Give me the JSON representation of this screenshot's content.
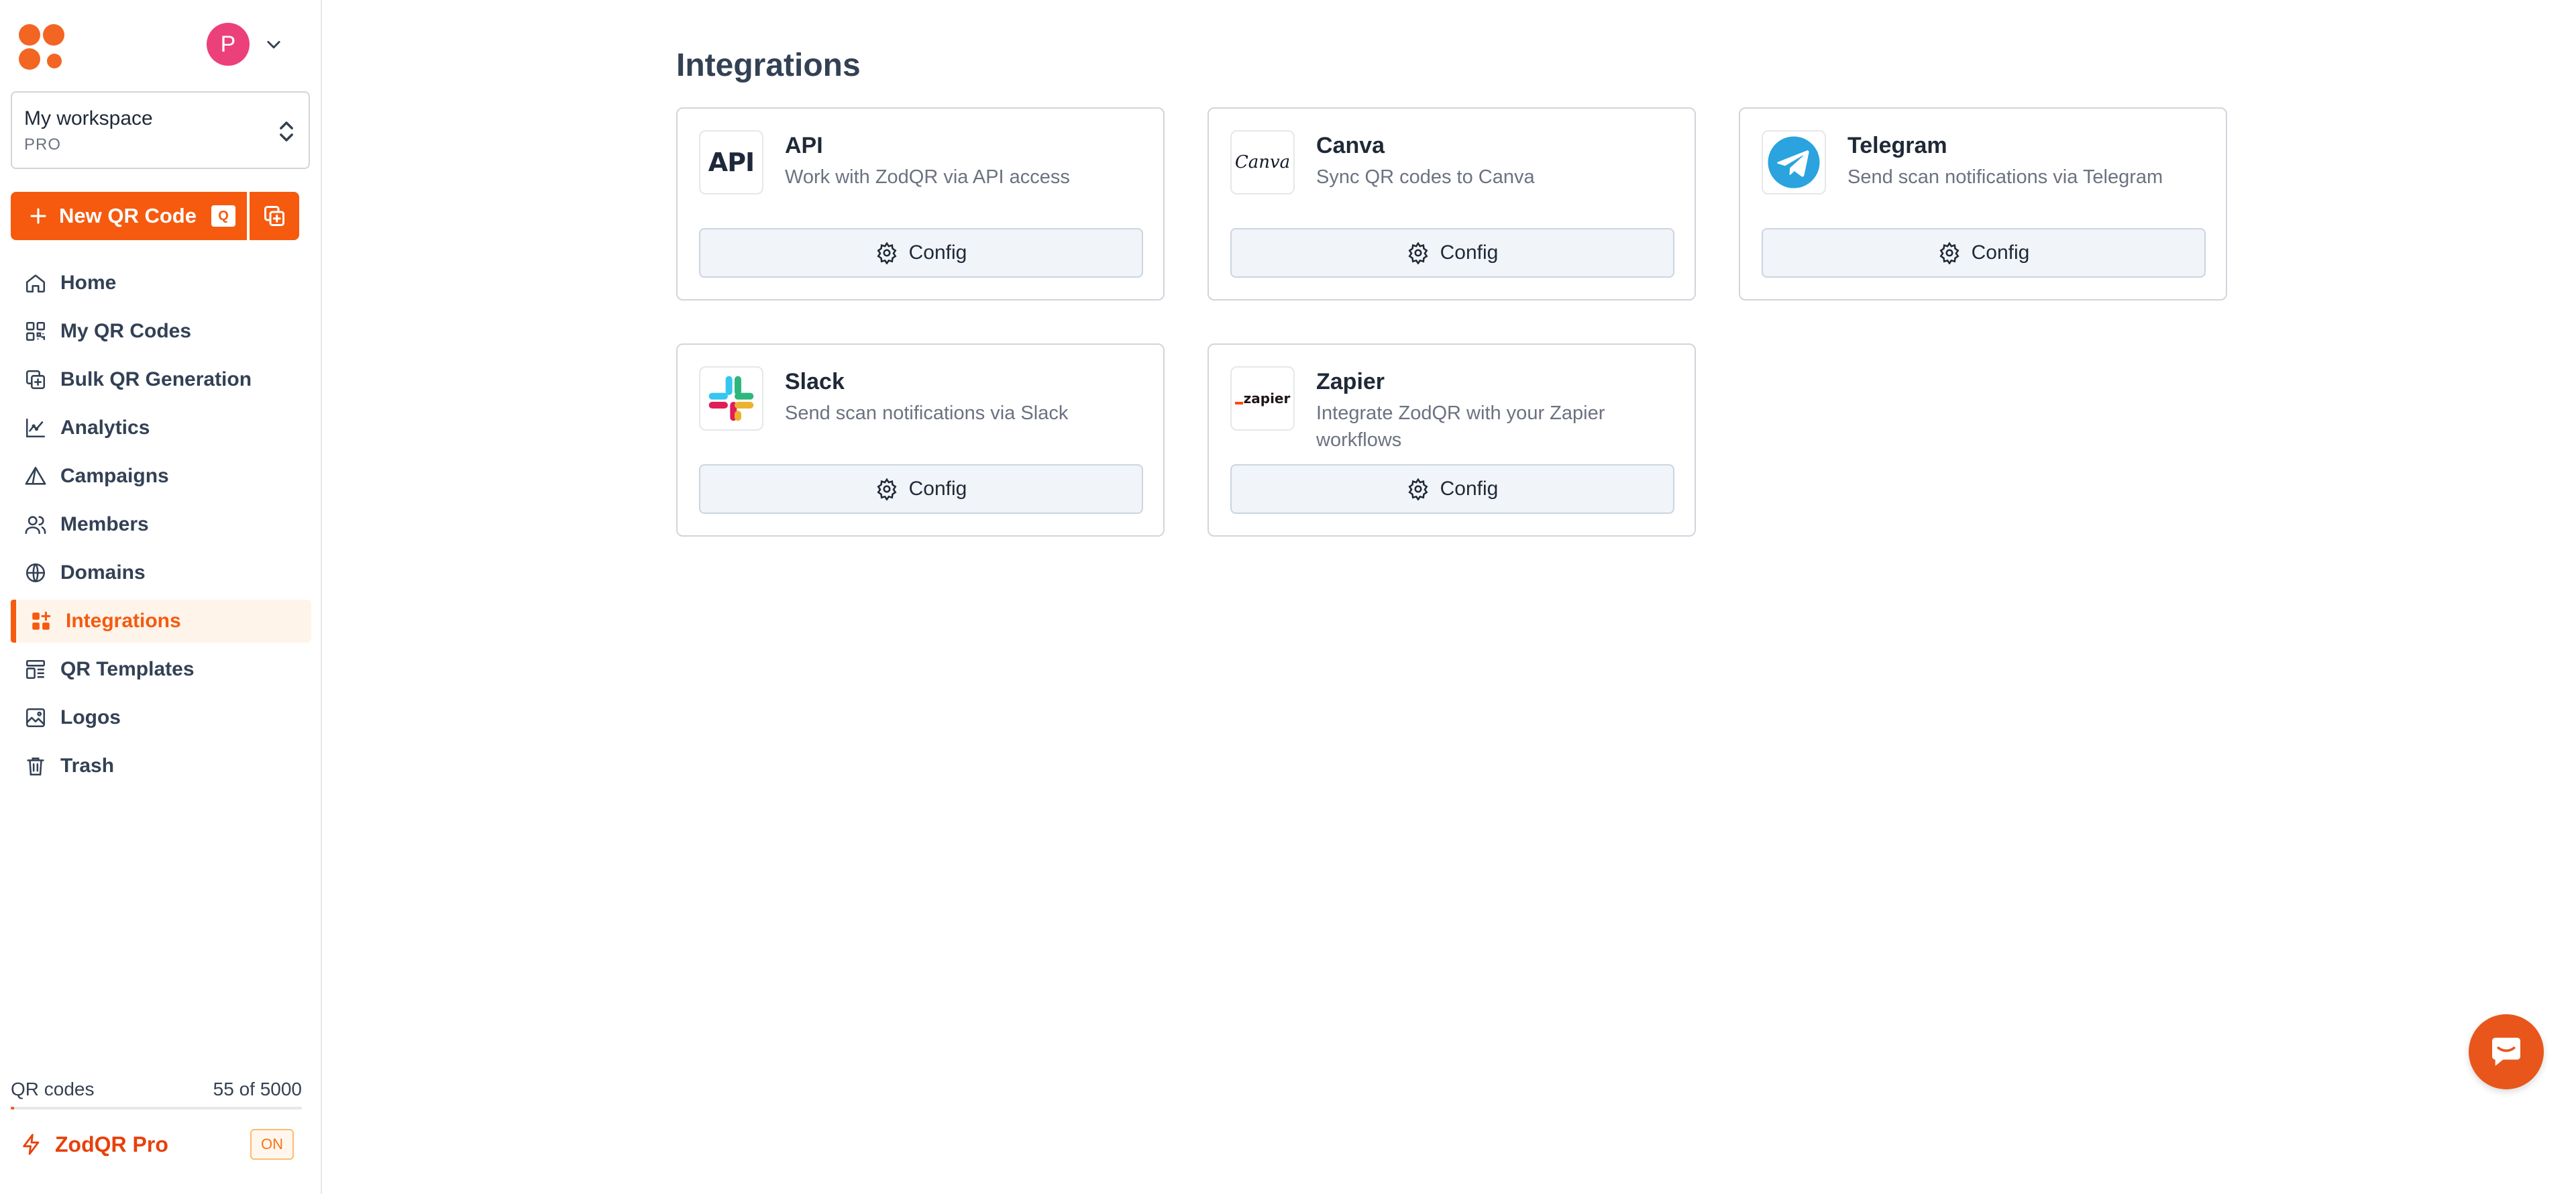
{
  "user": {
    "avatar_initial": "P"
  },
  "workspace": {
    "name": "My workspace",
    "plan": "PRO"
  },
  "new_qr": {
    "label": "New QR Code",
    "shortcut": "Q"
  },
  "nav": {
    "items": [
      {
        "label": "Home",
        "icon": "home-icon"
      },
      {
        "label": "My QR Codes",
        "icon": "qr-grid-icon"
      },
      {
        "label": "Bulk QR Generation",
        "icon": "bulk-copy-icon"
      },
      {
        "label": "Analytics",
        "icon": "analytics-icon"
      },
      {
        "label": "Campaigns",
        "icon": "campaign-icon"
      },
      {
        "label": "Members",
        "icon": "members-icon"
      },
      {
        "label": "Domains",
        "icon": "globe-icon"
      },
      {
        "label": "Integrations",
        "icon": "integrations-icon",
        "active": true
      },
      {
        "label": "QR Templates",
        "icon": "template-icon"
      },
      {
        "label": "Logos",
        "icon": "image-icon"
      },
      {
        "label": "Trash",
        "icon": "trash-icon"
      }
    ]
  },
  "usage": {
    "label": "QR codes",
    "count_text": "55 of 5000",
    "used": 55,
    "limit": 5000
  },
  "pro": {
    "label": "ZodQR Pro",
    "badge": "ON"
  },
  "page": {
    "title": "Integrations"
  },
  "integrations": [
    {
      "name": "API",
      "description": "Work with ZodQR via API access",
      "icon": "api-icon",
      "logo_text": "API",
      "button": "Config"
    },
    {
      "name": "Canva",
      "description": "Sync QR codes to Canva",
      "icon": "canva-icon",
      "logo_text": "Canva",
      "button": "Config"
    },
    {
      "name": "Telegram",
      "description": "Send scan notifications via Telegram",
      "icon": "telegram-icon",
      "button": "Config"
    },
    {
      "name": "Slack",
      "description": "Send scan notifications via Slack",
      "icon": "slack-icon",
      "button": "Config"
    },
    {
      "name": "Zapier",
      "description": "Integrate ZodQR with your Zapier workflows",
      "icon": "zapier-icon",
      "logo_text": "zapier",
      "button": "Config"
    }
  ],
  "colors": {
    "accent": "#f55a0f",
    "active_bg": "#fff4ea",
    "avatar": "#ec407a",
    "telegram": "#2aa3df"
  }
}
